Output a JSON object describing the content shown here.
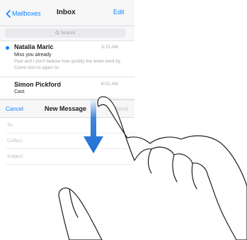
{
  "navbar": {
    "back_label": "Mailboxes",
    "title": "Inbox",
    "edit_label": "Edit"
  },
  "search": {
    "placeholder": "Search",
    "icon": "magnifier-icon"
  },
  "messages": [
    {
      "sender": "Natalia Maric",
      "time": "3:15 AM",
      "subject": "Miss you already",
      "preview": "Paul and I don't believe how quickly the week went by. Come visit us again so",
      "unread": true
    },
    {
      "sender": "Simon Pickford",
      "time": "6:02 AM",
      "subject": "Cast",
      "preview": "",
      "unread": false
    }
  ],
  "compose": {
    "cancel_label": "Cancel",
    "title": "New Message",
    "send_label": "Send",
    "fields": {
      "to_label": "To:",
      "cc_label": "Cc/Bcc:",
      "subject_label": "Subject:"
    }
  },
  "gesture": {
    "type": "swipe-down",
    "arrow_color": "#1f6fd6"
  },
  "colors": {
    "accent": "#0a84ff",
    "unread_dot": "#0a84ff"
  }
}
